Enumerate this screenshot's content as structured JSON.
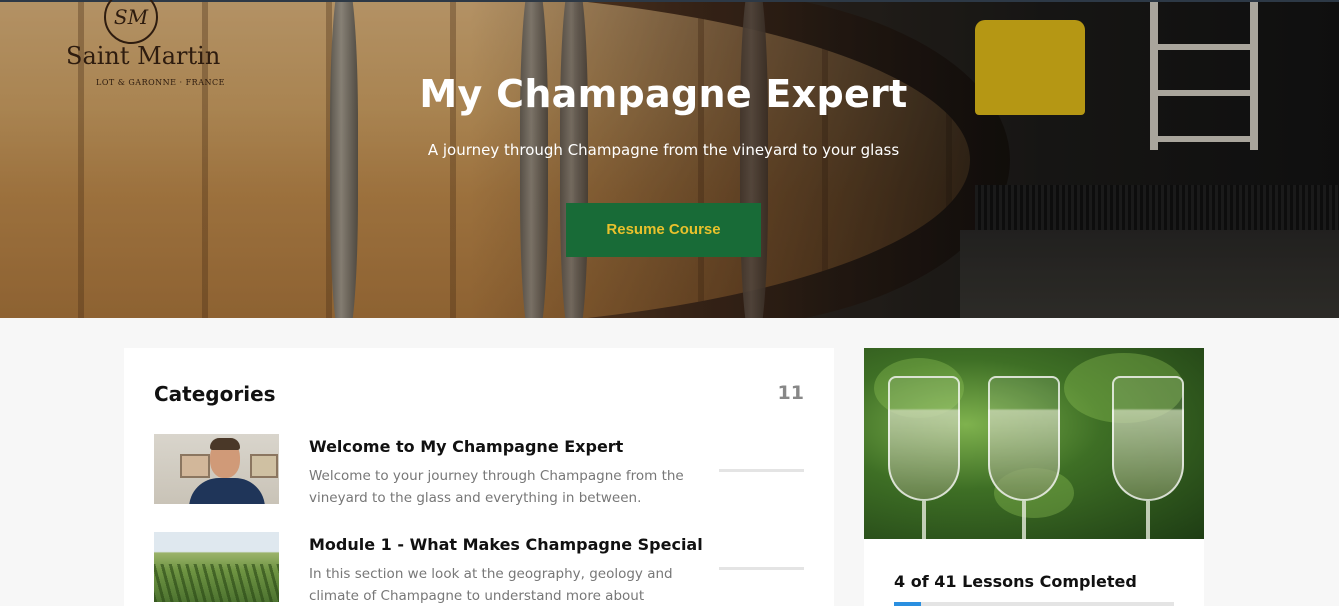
{
  "hero": {
    "brand_name": "Saint Martin",
    "brand_sub": "LOT & GARONNE · FRANCE",
    "brand_seal": "SM",
    "title": "My Champagne Expert",
    "subtitle": "A journey through Champagne from the vineyard to your glass",
    "resume_label": "Resume Course"
  },
  "categories": {
    "title": "Categories",
    "count": "11",
    "items": [
      {
        "name": "Welcome to My Champagne Expert",
        "description": "Welcome to your journey through Champagne from the vineyard to the glass and everything in between.",
        "thumbnail": "presenter-photo"
      },
      {
        "name": "Module 1 - What Makes Champagne Special",
        "description": "In this section we look at the geography, geology and climate of Champagne to understand more about",
        "thumbnail": "vineyard-photo"
      }
    ]
  },
  "progress": {
    "image": "champagne-glasses-photo",
    "text": "4 of 41 Lessons Completed",
    "completed": 4,
    "total": 41
  },
  "colors": {
    "button_bg": "#186b37",
    "button_text": "#e8c12c",
    "progress_fill": "#2a8fe0"
  }
}
